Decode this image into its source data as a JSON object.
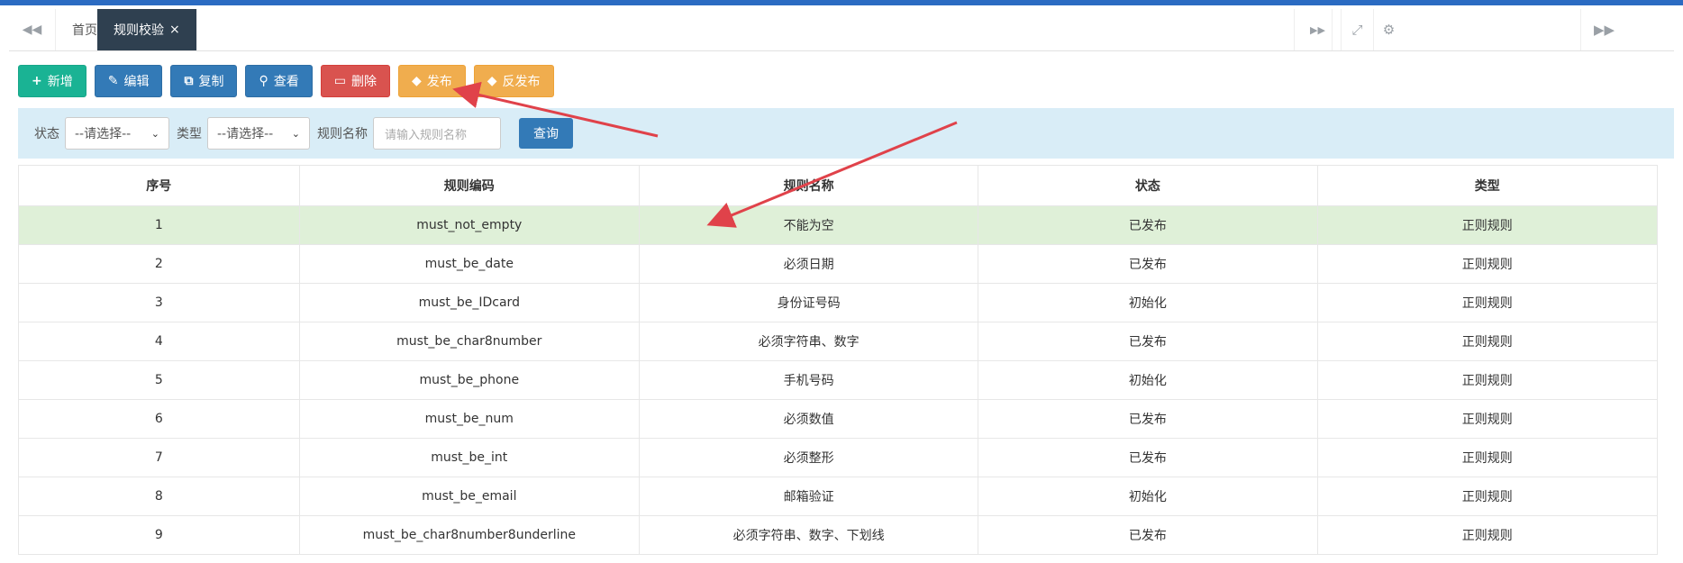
{
  "tabs": {
    "home_label": "首页",
    "active_label": "规则校验",
    "close_glyph": "×"
  },
  "toolbar": {
    "add_label": "新增",
    "edit_label": "编辑",
    "copy_label": "复制",
    "view_label": "查看",
    "delete_label": "删除",
    "publish_label": "发布",
    "unpublish_label": "反发布"
  },
  "search": {
    "status_label": "状态",
    "status_value": "--请选择--",
    "type_label": "类型",
    "type_value": "--请选择--",
    "name_label": "规则名称",
    "name_placeholder": "请输入规则名称",
    "query_label": "查询"
  },
  "table": {
    "headers": [
      "序号",
      "规则编码",
      "规则名称",
      "状态",
      "类型"
    ],
    "rows": [
      [
        "1",
        "must_not_empty",
        "不能为空",
        "已发布",
        "正则规则"
      ],
      [
        "2",
        "must_be_date",
        "必须日期",
        "已发布",
        "正则规则"
      ],
      [
        "3",
        "must_be_IDcard",
        "身份证号码",
        "初始化",
        "正则规则"
      ],
      [
        "4",
        "must_be_char8number",
        "必须字符串、数字",
        "已发布",
        "正则规则"
      ],
      [
        "5",
        "must_be_phone",
        "手机号码",
        "初始化",
        "正则规则"
      ],
      [
        "6",
        "must_be_num",
        "必须数值",
        "已发布",
        "正则规则"
      ],
      [
        "7",
        "must_be_int",
        "必须整形",
        "已发布",
        "正则规则"
      ],
      [
        "8",
        "must_be_email",
        "邮箱验证",
        "初始化",
        "正则规则"
      ],
      [
        "9",
        "must_be_char8number8underline",
        "必须字符串、数字、下划线",
        "已发布",
        "正则规则"
      ]
    ]
  },
  "colors": {
    "accent": "#2b6bc2",
    "tab_active": "#2f4050",
    "green": "#1ab394",
    "blue": "#337ab7",
    "red": "#d9534f",
    "orange": "#f0ad4e",
    "search_bg": "#d9edf7",
    "row_selected": "#dff0d8",
    "arrow": "#e0424a"
  }
}
